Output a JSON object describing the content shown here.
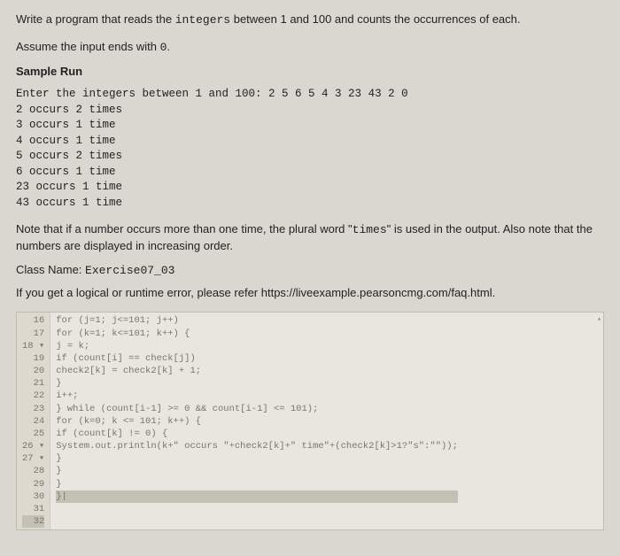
{
  "question": {
    "line1_pre": "Write a program that reads the ",
    "line1_mono": "integers",
    "line1_post": " between 1 and 100 and counts the occurrences of each.",
    "line2_pre": "Assume the input ends with ",
    "line2_mono": "0",
    "line2_post": "."
  },
  "sampleHeading": "Sample Run",
  "sampleRun": [
    "Enter the integers between 1 and 100: 2 5 6 5 4 3 23 43 2 0",
    "2 occurs 2 times",
    "3 occurs 1 time",
    "4 occurs 1 time",
    "5 occurs 2 times",
    "6 occurs 1 time",
    "23 occurs 1 time",
    "43 occurs 1 time"
  ],
  "note": {
    "pre": "Note that if a number occurs more than one time, the plural word \"",
    "mono": "times",
    "post": "\" is used in the output. Also note that the numbers are displayed in increasing order."
  },
  "classLabel": "Class Name: ",
  "className": "Exercise07_03",
  "faqText": "If you get a logical or runtime error, please refer https://liveexample.pearsoncmg.com/faq.html.",
  "code": {
    "startLine": 16,
    "lines": [
      "",
      "for (j=1; j<=101; j++)",
      "for (k=1; k<=101; k++) {",
      "j = k;",
      "if (count[i] == check[j])",
      "check2[k] = check2[k] + 1;",
      "}",
      "i++;",
      "} while (count[i-1] >= 0 && count[i-1] <= 101);",
      "",
      "for (k=0; k <= 101; k++) {",
      "if (count[k] != 0) {",
      "System.out.println(k+\" occurs \"+check2[k]+\" time\"+(check2[k]>1?\"s\":\"\"));",
      "}",
      "}",
      "}",
      "}|"
    ],
    "foldMarkers": {
      "18": "▾",
      "26": "▾",
      "27": "▾"
    }
  }
}
